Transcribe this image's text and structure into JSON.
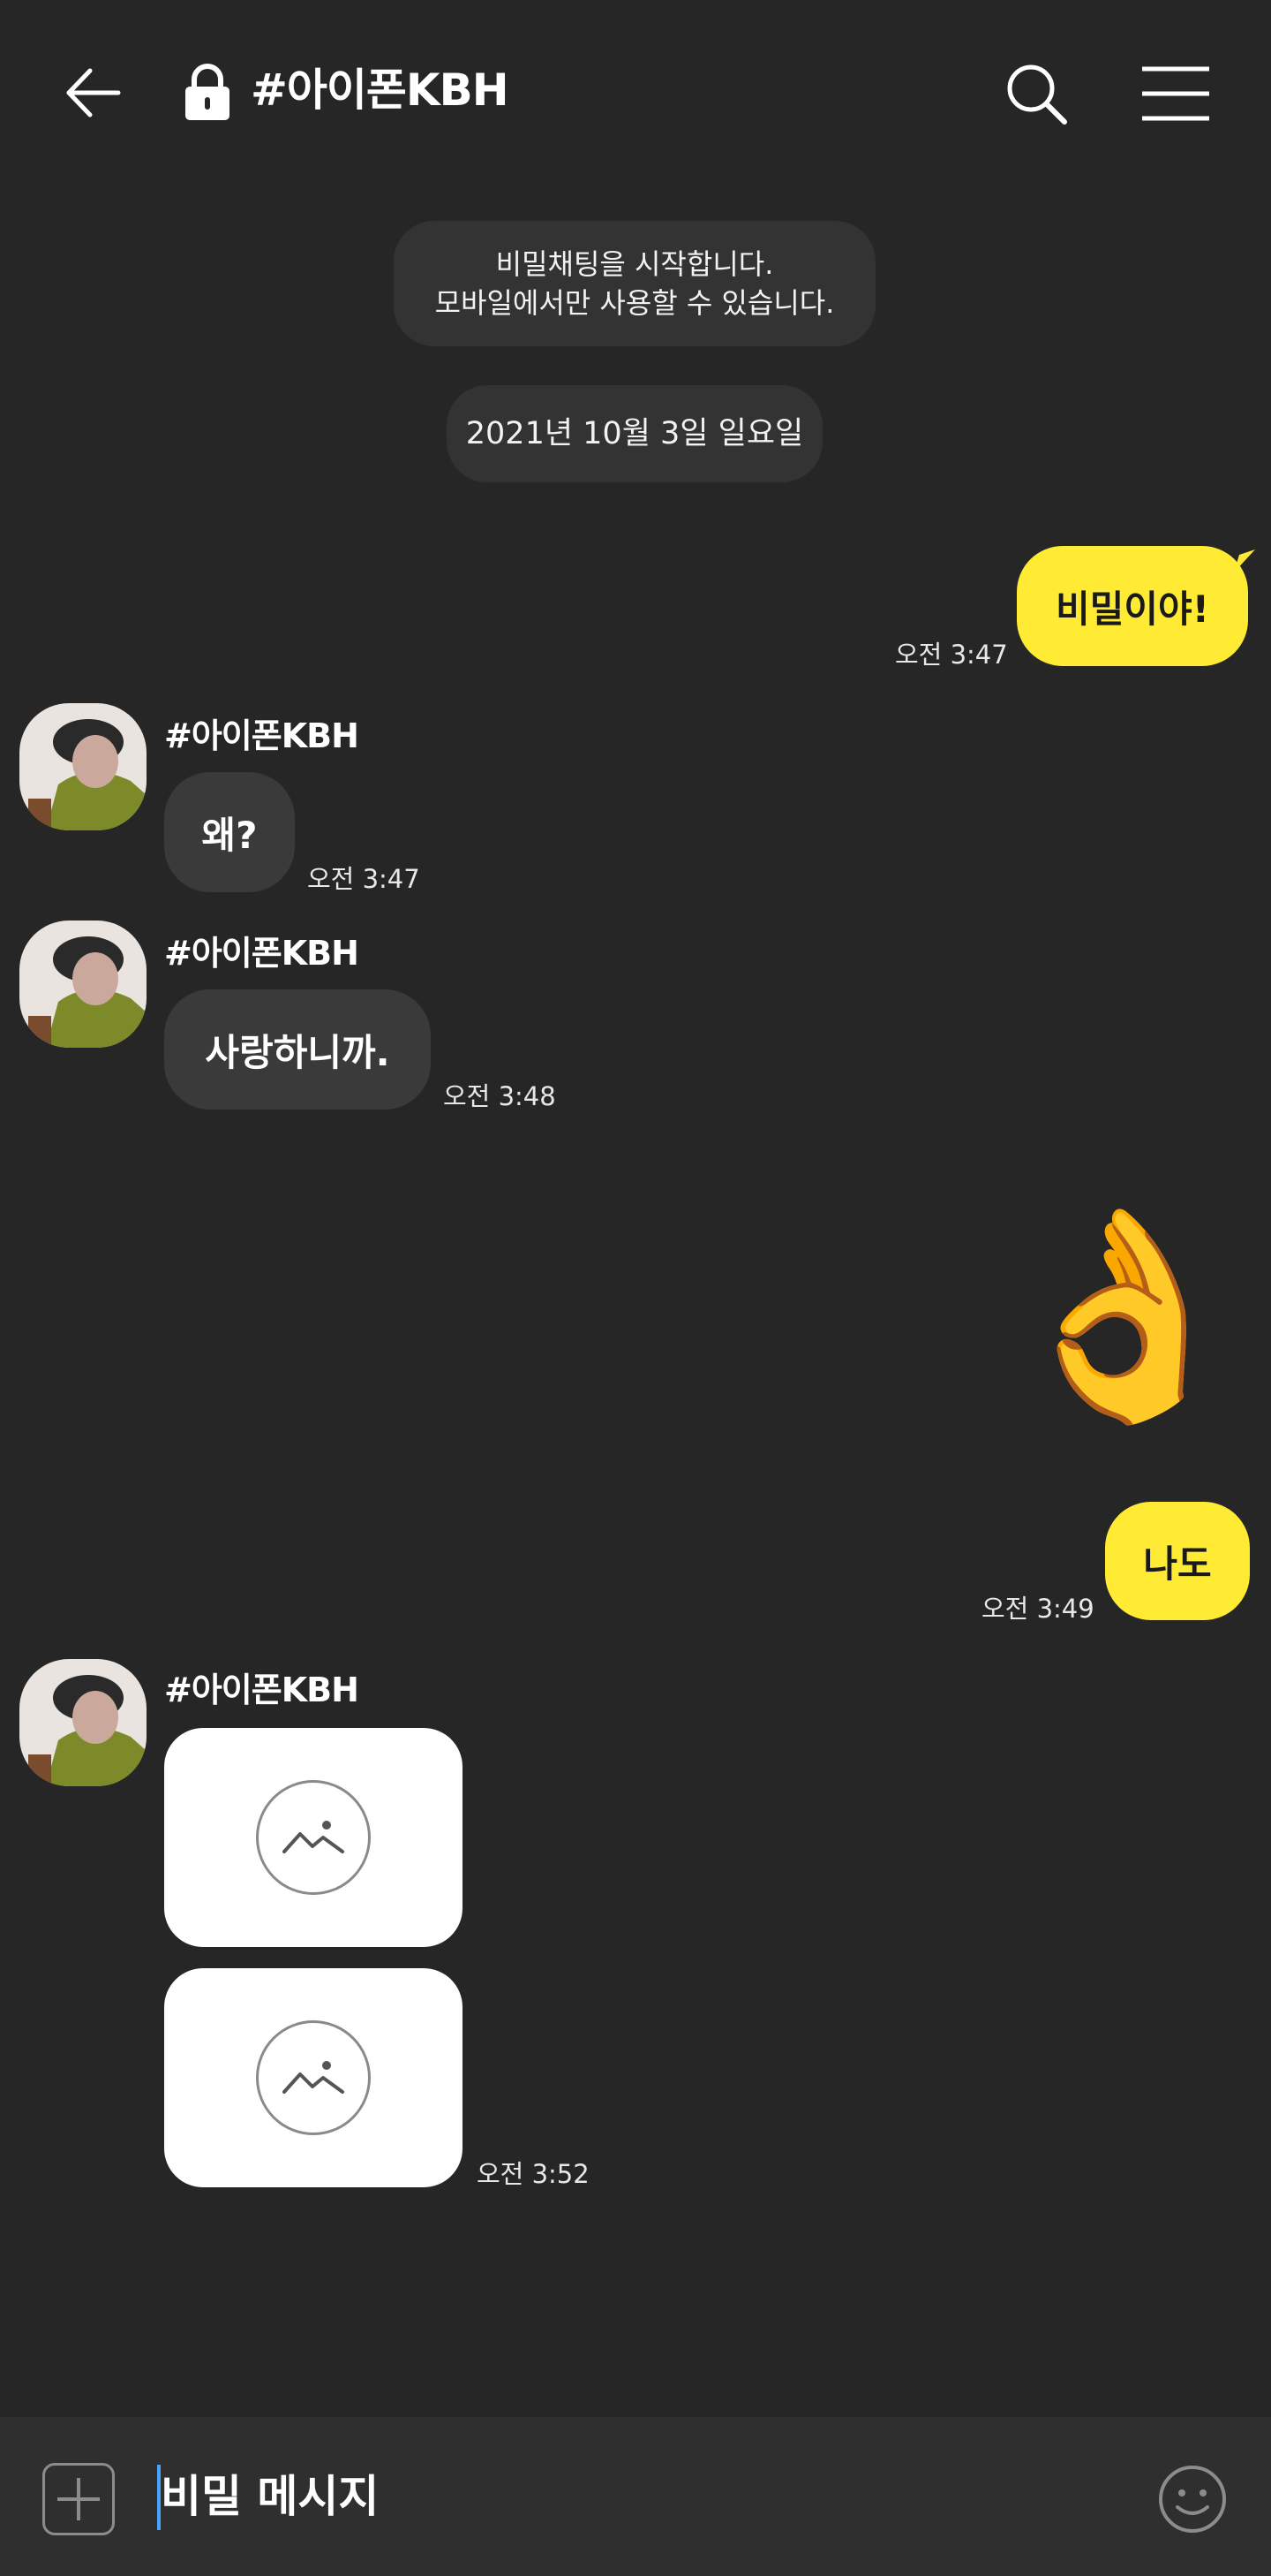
{
  "header": {
    "title": "#아이폰KBH",
    "back_icon": "arrow-left-icon",
    "lock_icon": "lock-icon",
    "search_icon": "search-icon",
    "menu_icon": "hamburger-menu-icon"
  },
  "notices": {
    "secret_line1": "비밀채팅을 시작합니다.",
    "secret_line2": "모바일에서만 사용할 수 있습니다.",
    "date": "2021년 10월 3일 일요일"
  },
  "messages": {
    "m1": {
      "text": "비밀이야!",
      "time": "오전 3:47",
      "from": "me"
    },
    "m2": {
      "sender": "#아이폰KBH",
      "text": "왜?",
      "time": "오전 3:47"
    },
    "m3": {
      "sender": "#아이폰KBH",
      "text": "사랑하니까.",
      "time": "오전 3:48"
    },
    "m4": {
      "emoji": "👌",
      "from": "me"
    },
    "m5": {
      "text": "나도",
      "time": "오전 3:49",
      "from": "me"
    },
    "m6": {
      "sender": "#아이폰KBH",
      "time": "오전 3:52",
      "images": [
        "image-placeholder-icon",
        "image-placeholder-icon"
      ]
    }
  },
  "input": {
    "text": "비밀 메시지",
    "plus_icon": "plus-icon",
    "emoticon_icon": "smiley-icon"
  },
  "colors": {
    "background": "#262626",
    "my_bubble": "#ffeb33",
    "other_bubble": "#3a3a3a"
  }
}
